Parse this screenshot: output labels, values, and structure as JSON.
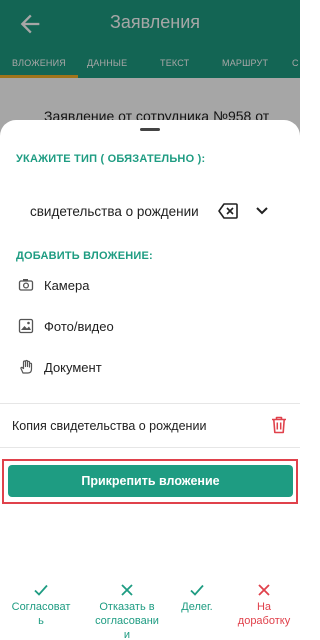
{
  "header": {
    "title": "Заявления"
  },
  "tabs": [
    {
      "label": "ВЛОЖЕНИЯ",
      "active": true
    },
    {
      "label": "ДАННЫЕ"
    },
    {
      "label": "ТЕКСТ"
    },
    {
      "label": "МАРШРУТ"
    },
    {
      "label": "С"
    }
  ],
  "background": {
    "text": "Заявление от сотрудника №958 от"
  },
  "sheet": {
    "type_section_label": "УКАЖИТЕ ТИП ( ОБЯЗАТЕЛЬНО ):",
    "type_value": "свидетельства о рождении",
    "attach_section_label": "ДОБАВИТЬ ВЛОЖЕНИЕ:",
    "options": [
      {
        "label": "Камера",
        "icon": "camera-icon"
      },
      {
        "label": "Фото/видео",
        "icon": "image-icon"
      },
      {
        "label": "Документ",
        "icon": "hand-icon"
      }
    ],
    "file_name": "Копия свидетельства о рождении",
    "attach_button": "Прикрепить вложение"
  },
  "actions": [
    {
      "label_lines": [
        "Согласоват",
        "ь"
      ],
      "icon": "check-icon",
      "color": "#1e9c82"
    },
    {
      "label_lines": [
        "Отказать в",
        "согласовани",
        "и"
      ],
      "icon": "close-icon",
      "color": "#1e9c82"
    },
    {
      "label_lines": [
        "Делег."
      ],
      "icon": "check-icon",
      "color": "#1e9c82"
    },
    {
      "label_lines": [
        "На",
        "доработку"
      ],
      "icon": "close-icon",
      "color": "#e0414b"
    }
  ],
  "colors": {
    "primary": "#1e9c82",
    "tab_indicator": "#f6b32a",
    "danger": "#e0414b"
  }
}
